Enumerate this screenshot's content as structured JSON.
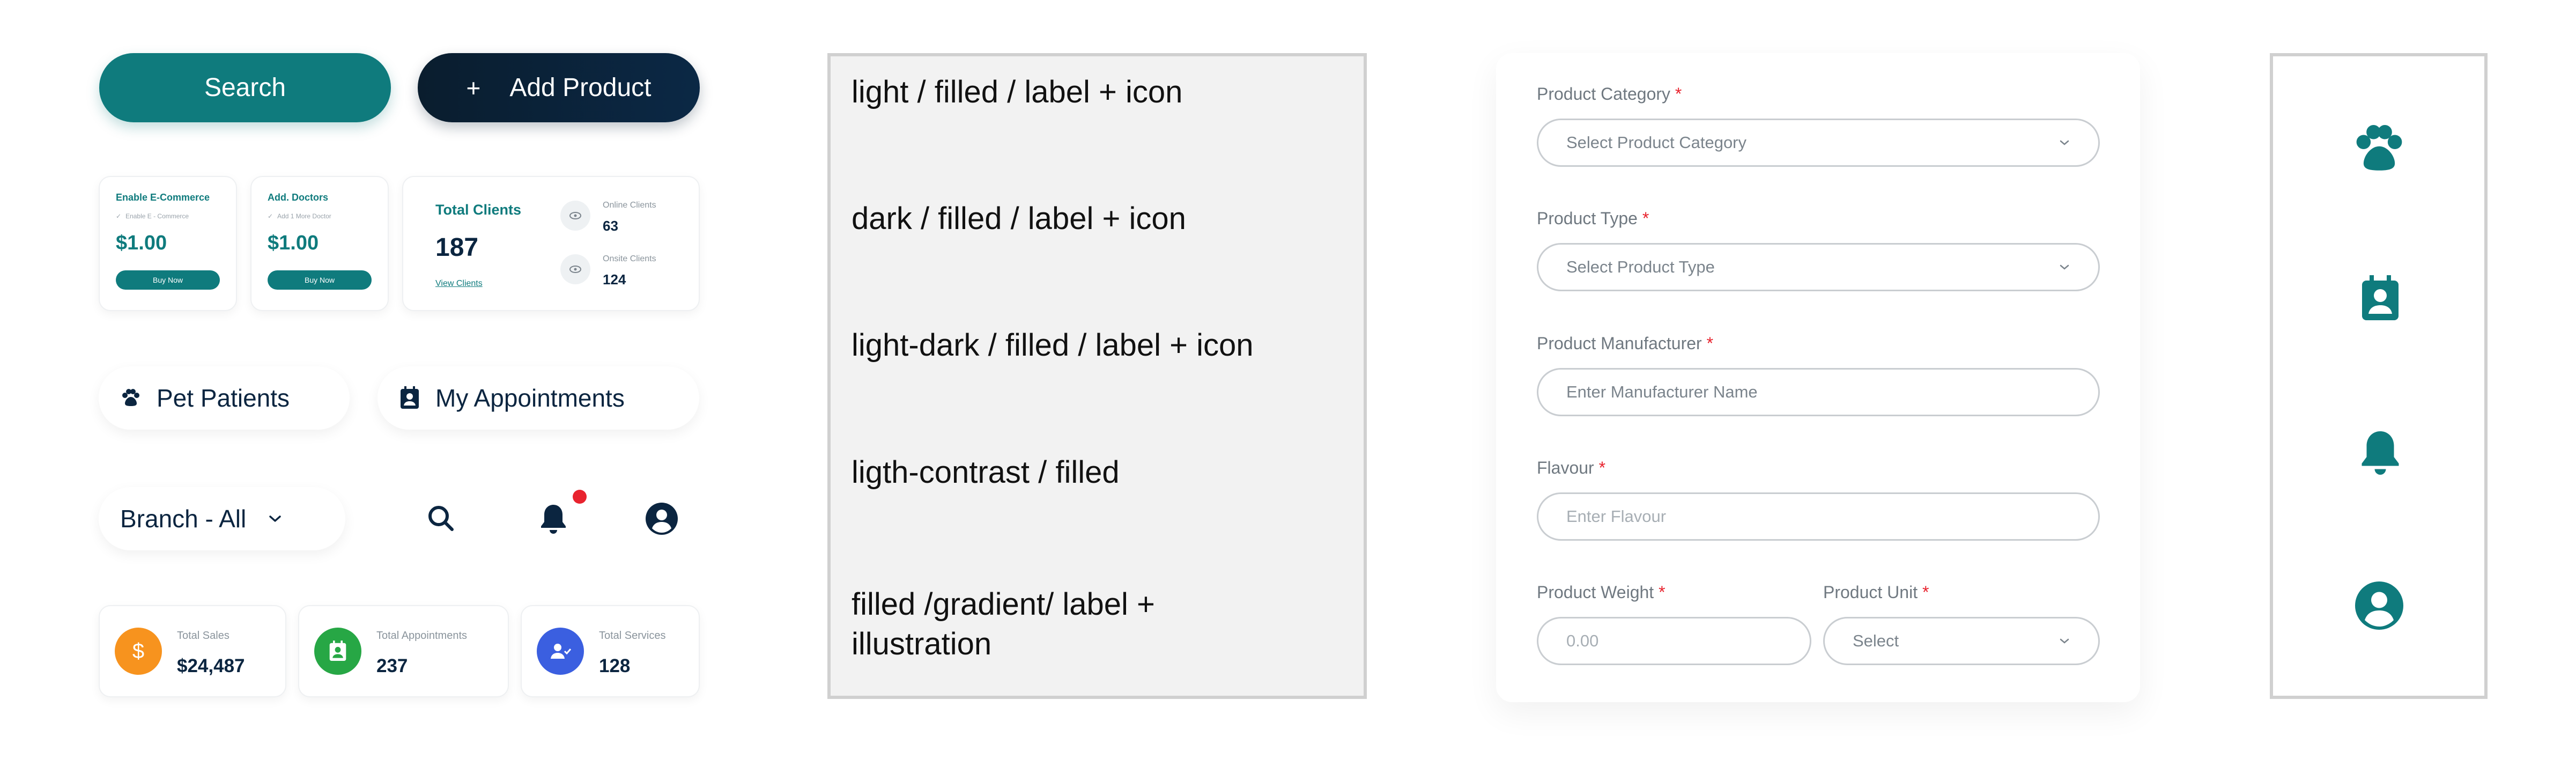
{
  "buttons": {
    "search_label": "Search",
    "add_plus": "+",
    "add_label": "Add Product"
  },
  "mini_cards": [
    {
      "title": "Enable E-Commerce",
      "sub": "Enable E - Commerce",
      "price": "$1.00",
      "button": "Buy Now"
    },
    {
      "title": "Add. Doctors",
      "sub": "Add 1 More Doctor",
      "price": "$1.00",
      "button": "Buy Now"
    }
  ],
  "clients": {
    "title": "Total Clients",
    "count": "187",
    "link": "View Clients",
    "online_label": "Online Clients",
    "online_value": "63",
    "onsite_label": "Onsite Clients",
    "onsite_value": "124"
  },
  "pills": {
    "pets": "Pet Patients",
    "appointments": "My Appointments",
    "branch": "Branch - All"
  },
  "stats": [
    {
      "label": "Total Sales",
      "value": "$24,487",
      "icon": "dollar-icon",
      "color": "#f7931e"
    },
    {
      "label": "Total Appointments",
      "value": "237",
      "icon": "appointment-icon",
      "color": "#27a745"
    },
    {
      "label": "Total Services",
      "value": "128",
      "icon": "services-icon",
      "color": "#3b5fe0"
    }
  ],
  "variants": [
    "light / filled / label + icon",
    "dark / filled / label + icon",
    "light-dark / filled / label + icon",
    "ligth-contrast / filled",
    "filled /gradient/ label + illustration"
  ],
  "form": {
    "category_label": "Product Category",
    "category_placeholder": "Select Product Category",
    "type_label": "Product Type",
    "type_placeholder": "Select Product Type",
    "manufacturer_label": "Product Manufacturer",
    "manufacturer_placeholder": "Enter Manufacturer Name",
    "flavour_label": "Flavour",
    "flavour_placeholder": "Enter Flavour",
    "weight_label": "Product Weight",
    "weight_placeholder": "0.00",
    "unit_label": "Product Unit",
    "unit_placeholder": "Select",
    "required_mark": "*"
  },
  "colors": {
    "teal": "#0f7b7d",
    "navy": "#0b2540",
    "red": "#e8232e"
  },
  "side_icons": [
    "paw-icon",
    "contact-icon",
    "bell-icon",
    "user-icon"
  ]
}
